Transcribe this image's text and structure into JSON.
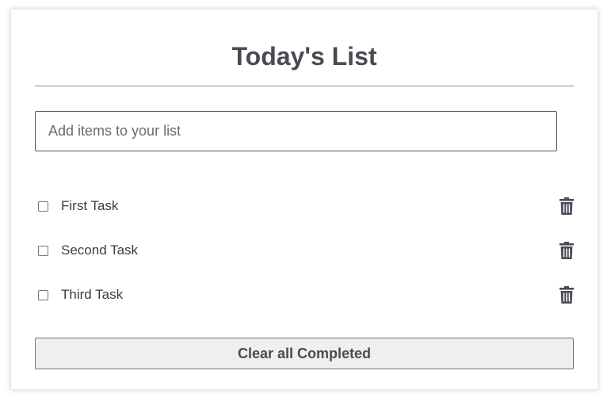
{
  "header": {
    "title": "Today's List"
  },
  "add_item": {
    "placeholder": "Add items to your list",
    "value": ""
  },
  "tasks": [
    {
      "label": "First Task",
      "checked": false,
      "delete_icon": "trash-icon"
    },
    {
      "label": "Second Task",
      "checked": false,
      "delete_icon": "trash-icon"
    },
    {
      "label": "Third Task",
      "checked": false,
      "delete_icon": "trash-icon"
    }
  ],
  "actions": {
    "clear_label": "Clear all Completed"
  },
  "colors": {
    "text": "#4a4a52",
    "icon": "#4a4a58",
    "button_bg": "#efefef",
    "border": "#767676"
  }
}
